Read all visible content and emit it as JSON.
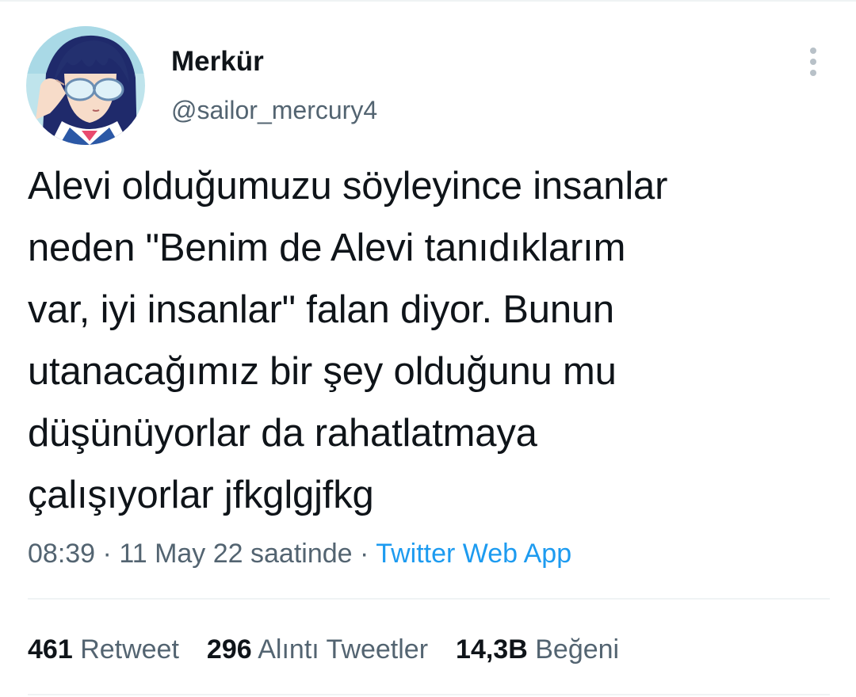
{
  "author": {
    "display_name": "Merkür",
    "handle": "@sailor_mercury4",
    "avatar_icon": "anime-avatar-icon"
  },
  "more_icon": "more-vertical-icon",
  "tweet": {
    "text": "Alevi olduğumuzu söyleyince insanlar\nneden \"Benim de Alevi tanıdıklarım\nvar, iyi insanlar\" falan diyor. Bunun\nutanacağımız bir şey olduğunu mu\ndüşünüyorlar da rahatlatmaya\nçalışıyorlar jfkglgjfkg"
  },
  "meta": {
    "time": "08:39",
    "date": "11 May 22 saatinde",
    "separator": "·",
    "source": "Twitter Web App"
  },
  "stats": {
    "retweets": {
      "count": "461",
      "label": "Retweet"
    },
    "quotes": {
      "count": "296",
      "label": "Alıntı Tweetler"
    },
    "likes": {
      "count": "14,3B",
      "label": "Beğeni"
    }
  },
  "colors": {
    "text_primary": "#0f1419",
    "text_secondary": "#536471",
    "link": "#1d9bf0",
    "divider": "#eff3f4"
  }
}
